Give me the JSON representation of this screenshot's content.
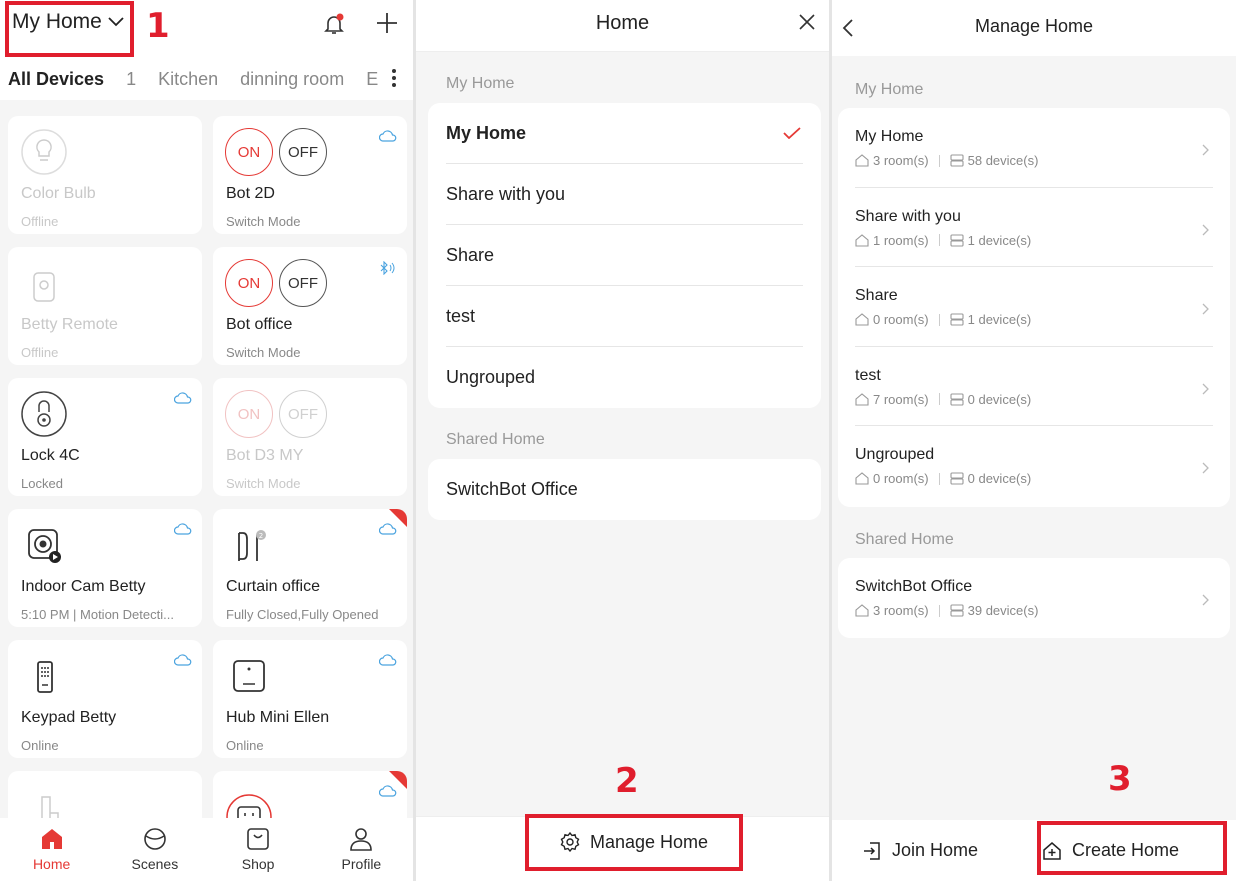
{
  "panel_home": {
    "home_name": "My Home",
    "tabs": [
      "All Devices",
      "1",
      "Kitchen",
      "dinning room",
      "E"
    ],
    "devices": [
      {
        "name": "Color Bulb",
        "status": "Offline",
        "offline": true
      },
      {
        "name": "Bot 2D",
        "status": "Switch Mode",
        "on_label": "ON",
        "off_label": "OFF"
      },
      {
        "name": "Betty Remote",
        "status": "Offline",
        "offline": true
      },
      {
        "name": "Bot office",
        "status": "Switch Mode",
        "on_label": "ON",
        "off_label": "OFF"
      },
      {
        "name": "Lock 4C",
        "status": "Locked"
      },
      {
        "name": "Bot D3  MY",
        "status": "Switch Mode",
        "on_label": "ON",
        "off_label": "OFF",
        "offline": true
      },
      {
        "name": "Indoor Cam Betty",
        "status": "5:10 PM | Motion Detecti..."
      },
      {
        "name": "Curtain office",
        "status": "Fully Closed,Fully Opened"
      },
      {
        "name": "Keypad Betty",
        "status": "Online"
      },
      {
        "name": "Hub Mini Ellen",
        "status": "Online"
      }
    ],
    "nav": [
      "Home",
      "Scenes",
      "Shop",
      "Profile"
    ]
  },
  "panel_select": {
    "title": "Home",
    "my_home_label": "My Home",
    "my_homes": [
      "My Home",
      "Share with you",
      "Share",
      "test",
      "Ungrouped"
    ],
    "selected": "My Home",
    "shared_label": "Shared Home",
    "shared_homes": [
      "SwitchBot Office"
    ],
    "manage_button": "Manage Home"
  },
  "panel_manage": {
    "title": "Manage Home",
    "my_home_label": "My Home",
    "homes": [
      {
        "name": "My Home",
        "rooms": "3 room(s)",
        "devices": "58 device(s)"
      },
      {
        "name": "Share with you",
        "rooms": "1 room(s)",
        "devices": "1 device(s)"
      },
      {
        "name": "Share",
        "rooms": "0 room(s)",
        "devices": "1 device(s)"
      },
      {
        "name": "test",
        "rooms": "7 room(s)",
        "devices": "0 device(s)"
      },
      {
        "name": "Ungrouped",
        "rooms": "0 room(s)",
        "devices": "0 device(s)"
      }
    ],
    "shared_label": "Shared Home",
    "shared_homes": [
      {
        "name": "SwitchBot Office",
        "rooms": "3 room(s)",
        "devices": "39 device(s)"
      }
    ],
    "join_button": "Join Home",
    "create_button": "Create Home"
  },
  "annotations": {
    "step1": "1",
    "step2": "2",
    "step3": "3"
  },
  "colors": {
    "accent": "#e53935",
    "annotation": "#e01e2d",
    "cloud": "#4aa3df"
  }
}
